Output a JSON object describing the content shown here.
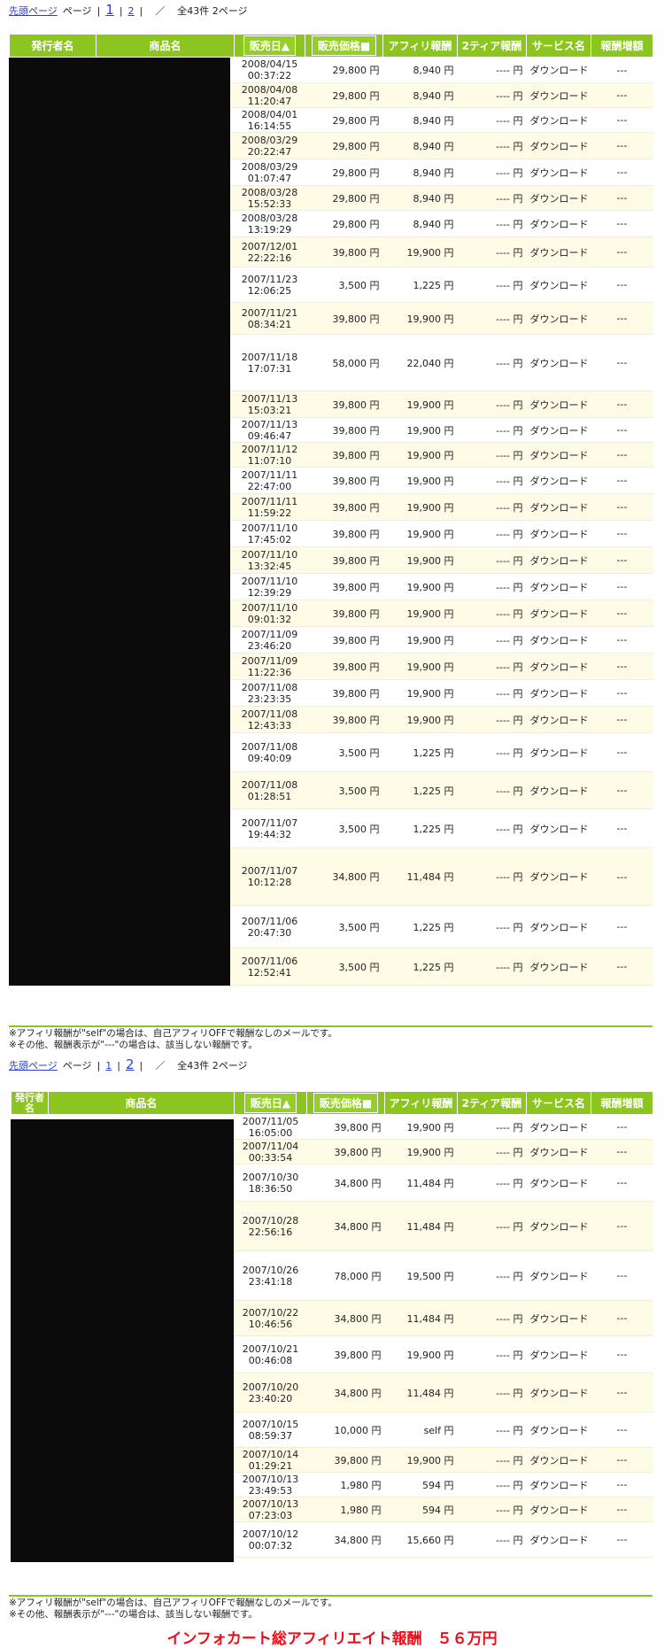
{
  "pager": {
    "first_link": "先頭ページ",
    "page_label": "ページ",
    "page1": "1",
    "page2": "2",
    "divider": "／",
    "summary": "全43件 2ページ"
  },
  "headers": {
    "publisher": "発行者名",
    "product": "商品名",
    "sale_date": "販売日▲",
    "sale_price": "販売価格■",
    "affiliate": "アフィリ報酬",
    "tier2": "2ティア報酬",
    "service": "サービス名",
    "bonus": "報酬増額"
  },
  "table1_rows": [
    {
      "date": "2008/04/15",
      "time": "00:37:22",
      "price": "29,800 円",
      "affiliate": "8,940 円",
      "tier2": "---- 円",
      "service": "ダウンロード",
      "bonus": "---"
    },
    {
      "date": "2008/04/08",
      "time": "11:20:47",
      "price": "29,800 円",
      "affiliate": "8,940 円",
      "tier2": "---- 円",
      "service": "ダウンロード",
      "bonus": "---"
    },
    {
      "date": "2008/04/01",
      "time": "16:14:55",
      "price": "29,800 円",
      "affiliate": "8,940 円",
      "tier2": "---- 円",
      "service": "ダウンロード",
      "bonus": "---"
    },
    {
      "date": "2008/03/29",
      "time": "20:22:47",
      "price": "29,800 円",
      "affiliate": "8,940 円",
      "tier2": "---- 円",
      "service": "ダウンロード",
      "bonus": "---"
    },
    {
      "date": "2008/03/29",
      "time": "01:07:47",
      "price": "29,800 円",
      "affiliate": "8,940 円",
      "tier2": "---- 円",
      "service": "ダウンロード",
      "bonus": "---"
    },
    {
      "date": "2008/03/28",
      "time": "15:52:33",
      "price": "29,800 円",
      "affiliate": "8,940 円",
      "tier2": "---- 円",
      "service": "ダウンロード",
      "bonus": "---"
    },
    {
      "date": "2008/03/28",
      "time": "13:19:29",
      "price": "29,800 円",
      "affiliate": "8,940 円",
      "tier2": "---- 円",
      "service": "ダウンロード",
      "bonus": "---"
    },
    {
      "date": "2007/12/01",
      "time": "22:22:16",
      "price": "39,800 円",
      "affiliate": "19,900 円",
      "tier2": "---- 円",
      "service": "ダウンロード",
      "bonus": "---"
    },
    {
      "date": "2007/11/23",
      "time": "12:06:25",
      "price": "3,500 円",
      "affiliate": "1,225 円",
      "tier2": "---- 円",
      "service": "ダウンロード",
      "bonus": "---"
    },
    {
      "date": "2007/11/21",
      "time": "08:34:21",
      "price": "39,800 円",
      "affiliate": "19,900 円",
      "tier2": "---- 円",
      "service": "ダウンロード",
      "bonus": "---"
    },
    {
      "date": "2007/11/18",
      "time": "17:07:31",
      "price": "58,000 円",
      "affiliate": "22,040 円",
      "tier2": "---- 円",
      "service": "ダウンロード",
      "bonus": "---"
    },
    {
      "date": "2007/11/13",
      "time": "15:03:21",
      "price": "39,800 円",
      "affiliate": "19,900 円",
      "tier2": "---- 円",
      "service": "ダウンロード",
      "bonus": "---"
    },
    {
      "date": "2007/11/13",
      "time": "09:46:47",
      "price": "39,800 円",
      "affiliate": "19,900 円",
      "tier2": "---- 円",
      "service": "ダウンロード",
      "bonus": "---"
    },
    {
      "date": "2007/11/12",
      "time": "11:07:10",
      "price": "39,800 円",
      "affiliate": "19,900 円",
      "tier2": "---- 円",
      "service": "ダウンロード",
      "bonus": "---"
    },
    {
      "date": "2007/11/11",
      "time": "22:47:00",
      "price": "39,800 円",
      "affiliate": "19,900 円",
      "tier2": "---- 円",
      "service": "ダウンロード",
      "bonus": "---"
    },
    {
      "date": "2007/11/11",
      "time": "11:59:22",
      "price": "39,800 円",
      "affiliate": "19,900 円",
      "tier2": "---- 円",
      "service": "ダウンロード",
      "bonus": "---"
    },
    {
      "date": "2007/11/10",
      "time": "17:45:02",
      "price": "39,800 円",
      "affiliate": "19,900 円",
      "tier2": "---- 円",
      "service": "ダウンロード",
      "bonus": "---"
    },
    {
      "date": "2007/11/10",
      "time": "13:32:45",
      "price": "39,800 円",
      "affiliate": "19,900 円",
      "tier2": "---- 円",
      "service": "ダウンロード",
      "bonus": "---"
    },
    {
      "date": "2007/11/10",
      "time": "12:39:29",
      "price": "39,800 円",
      "affiliate": "19,900 円",
      "tier2": "---- 円",
      "service": "ダウンロード",
      "bonus": "---"
    },
    {
      "date": "2007/11/10",
      "time": "09:01:32",
      "price": "39,800 円",
      "affiliate": "19,900 円",
      "tier2": "---- 円",
      "service": "ダウンロード",
      "bonus": "---"
    },
    {
      "date": "2007/11/09",
      "time": "23:46:20",
      "price": "39,800 円",
      "affiliate": "19,900 円",
      "tier2": "---- 円",
      "service": "ダウンロード",
      "bonus": "---"
    },
    {
      "date": "2007/11/09",
      "time": "11:22:36",
      "price": "39,800 円",
      "affiliate": "19,900 円",
      "tier2": "---- 円",
      "service": "ダウンロード",
      "bonus": "---"
    },
    {
      "date": "2007/11/08",
      "time": "23:23:35",
      "price": "39,800 円",
      "affiliate": "19,900 円",
      "tier2": "---- 円",
      "service": "ダウンロード",
      "bonus": "---"
    },
    {
      "date": "2007/11/08",
      "time": "12:43:33",
      "price": "39,800 円",
      "affiliate": "19,900 円",
      "tier2": "---- 円",
      "service": "ダウンロード",
      "bonus": "---"
    },
    {
      "date": "2007/11/08",
      "time": "09:40:09",
      "price": "3,500 円",
      "affiliate": "1,225 円",
      "tier2": "---- 円",
      "service": "ダウンロード",
      "bonus": "---"
    },
    {
      "date": "2007/11/08",
      "time": "01:28:51",
      "price": "3,500 円",
      "affiliate": "1,225 円",
      "tier2": "---- 円",
      "service": "ダウンロード",
      "bonus": "---"
    },
    {
      "date": "2007/11/07",
      "time": "19:44:32",
      "price": "3,500 円",
      "affiliate": "1,225 円",
      "tier2": "---- 円",
      "service": "ダウンロード",
      "bonus": "---"
    },
    {
      "date": "2007/11/07",
      "time": "10:12:28",
      "price": "34,800 円",
      "affiliate": "11,484 円",
      "tier2": "---- 円",
      "service": "ダウンロード",
      "bonus": "---"
    },
    {
      "date": "2007/11/06",
      "time": "20:47:30",
      "price": "3,500 円",
      "affiliate": "1,225 円",
      "tier2": "---- 円",
      "service": "ダウンロード",
      "bonus": "---"
    },
    {
      "date": "2007/11/06",
      "time": "12:52:41",
      "price": "3,500 円",
      "affiliate": "1,225 円",
      "tier2": "---- 円",
      "service": "ダウンロード",
      "bonus": "---"
    }
  ],
  "table2_rows": [
    {
      "date": "2007/11/05",
      "time": "16:05:00",
      "price": "39,800 円",
      "affiliate": "19,900 円",
      "tier2": "---- 円",
      "service": "ダウンロード",
      "bonus": "---"
    },
    {
      "date": "2007/11/04",
      "time": "00:33:54",
      "price": "39,800 円",
      "affiliate": "19,900 円",
      "tier2": "---- 円",
      "service": "ダウンロード",
      "bonus": "---"
    },
    {
      "date": "2007/10/30",
      "time": "18:36:50",
      "price": "34,800 円",
      "affiliate": "11,484 円",
      "tier2": "---- 円",
      "service": "ダウンロード",
      "bonus": "---"
    },
    {
      "date": "2007/10/28",
      "time": "22:56:16",
      "price": "34,800 円",
      "affiliate": "11,484 円",
      "tier2": "---- 円",
      "service": "ダウンロード",
      "bonus": "---"
    },
    {
      "date": "2007/10/26",
      "time": "23:41:18",
      "price": "78,000 円",
      "affiliate": "19,500 円",
      "tier2": "---- 円",
      "service": "ダウンロード",
      "bonus": "---"
    },
    {
      "date": "2007/10/22",
      "time": "10:46:56",
      "price": "34,800 円",
      "affiliate": "11,484 円",
      "tier2": "---- 円",
      "service": "ダウンロード",
      "bonus": "---"
    },
    {
      "date": "2007/10/21",
      "time": "00:46:08",
      "price": "39,800 円",
      "affiliate": "19,900 円",
      "tier2": "---- 円",
      "service": "ダウンロード",
      "bonus": "---"
    },
    {
      "date": "2007/10/20",
      "time": "23:40:20",
      "price": "34,800 円",
      "affiliate": "11,484 円",
      "tier2": "---- 円",
      "service": "ダウンロード",
      "bonus": "---"
    },
    {
      "date": "2007/10/15",
      "time": "08:59:37",
      "price": "10,000 円",
      "affiliate": "self 円",
      "tier2": "---- 円",
      "service": "ダウンロード",
      "bonus": "---"
    },
    {
      "date": "2007/10/14",
      "time": "01:29:21",
      "price": "39,800 円",
      "affiliate": "19,900 円",
      "tier2": "---- 円",
      "service": "ダウンロード",
      "bonus": "---"
    },
    {
      "date": "2007/10/13",
      "time": "23:49:53",
      "price": "1,980 円",
      "affiliate": "594 円",
      "tier2": "---- 円",
      "service": "ダウンロード",
      "bonus": "---"
    },
    {
      "date": "2007/10/13",
      "time": "07:23:03",
      "price": "1,980 円",
      "affiliate": "594 円",
      "tier2": "---- 円",
      "service": "ダウンロード",
      "bonus": "---"
    },
    {
      "date": "2007/10/12",
      "time": "00:07:32",
      "price": "34,800 円",
      "affiliate": "15,660 円",
      "tier2": "---- 円",
      "service": "ダウンロード",
      "bonus": "---"
    }
  ],
  "notes": {
    "line1": "※アフィリ報酬が\"self\"の場合は、自己アフィリOFFで報酬なしのメールです。",
    "line2": "※その他、報酬表示が\"---\"の場合は、該当しない報酬です。"
  },
  "total_text": "インフォカート総アフィリエイト報酬　５６万円",
  "colors": {
    "header_green": "#8cc51f",
    "row_alt": "#fdfbe6",
    "redaction": "#0b0b0b",
    "total_red": "#e8101a",
    "link_blue": "#2b3fc8"
  }
}
